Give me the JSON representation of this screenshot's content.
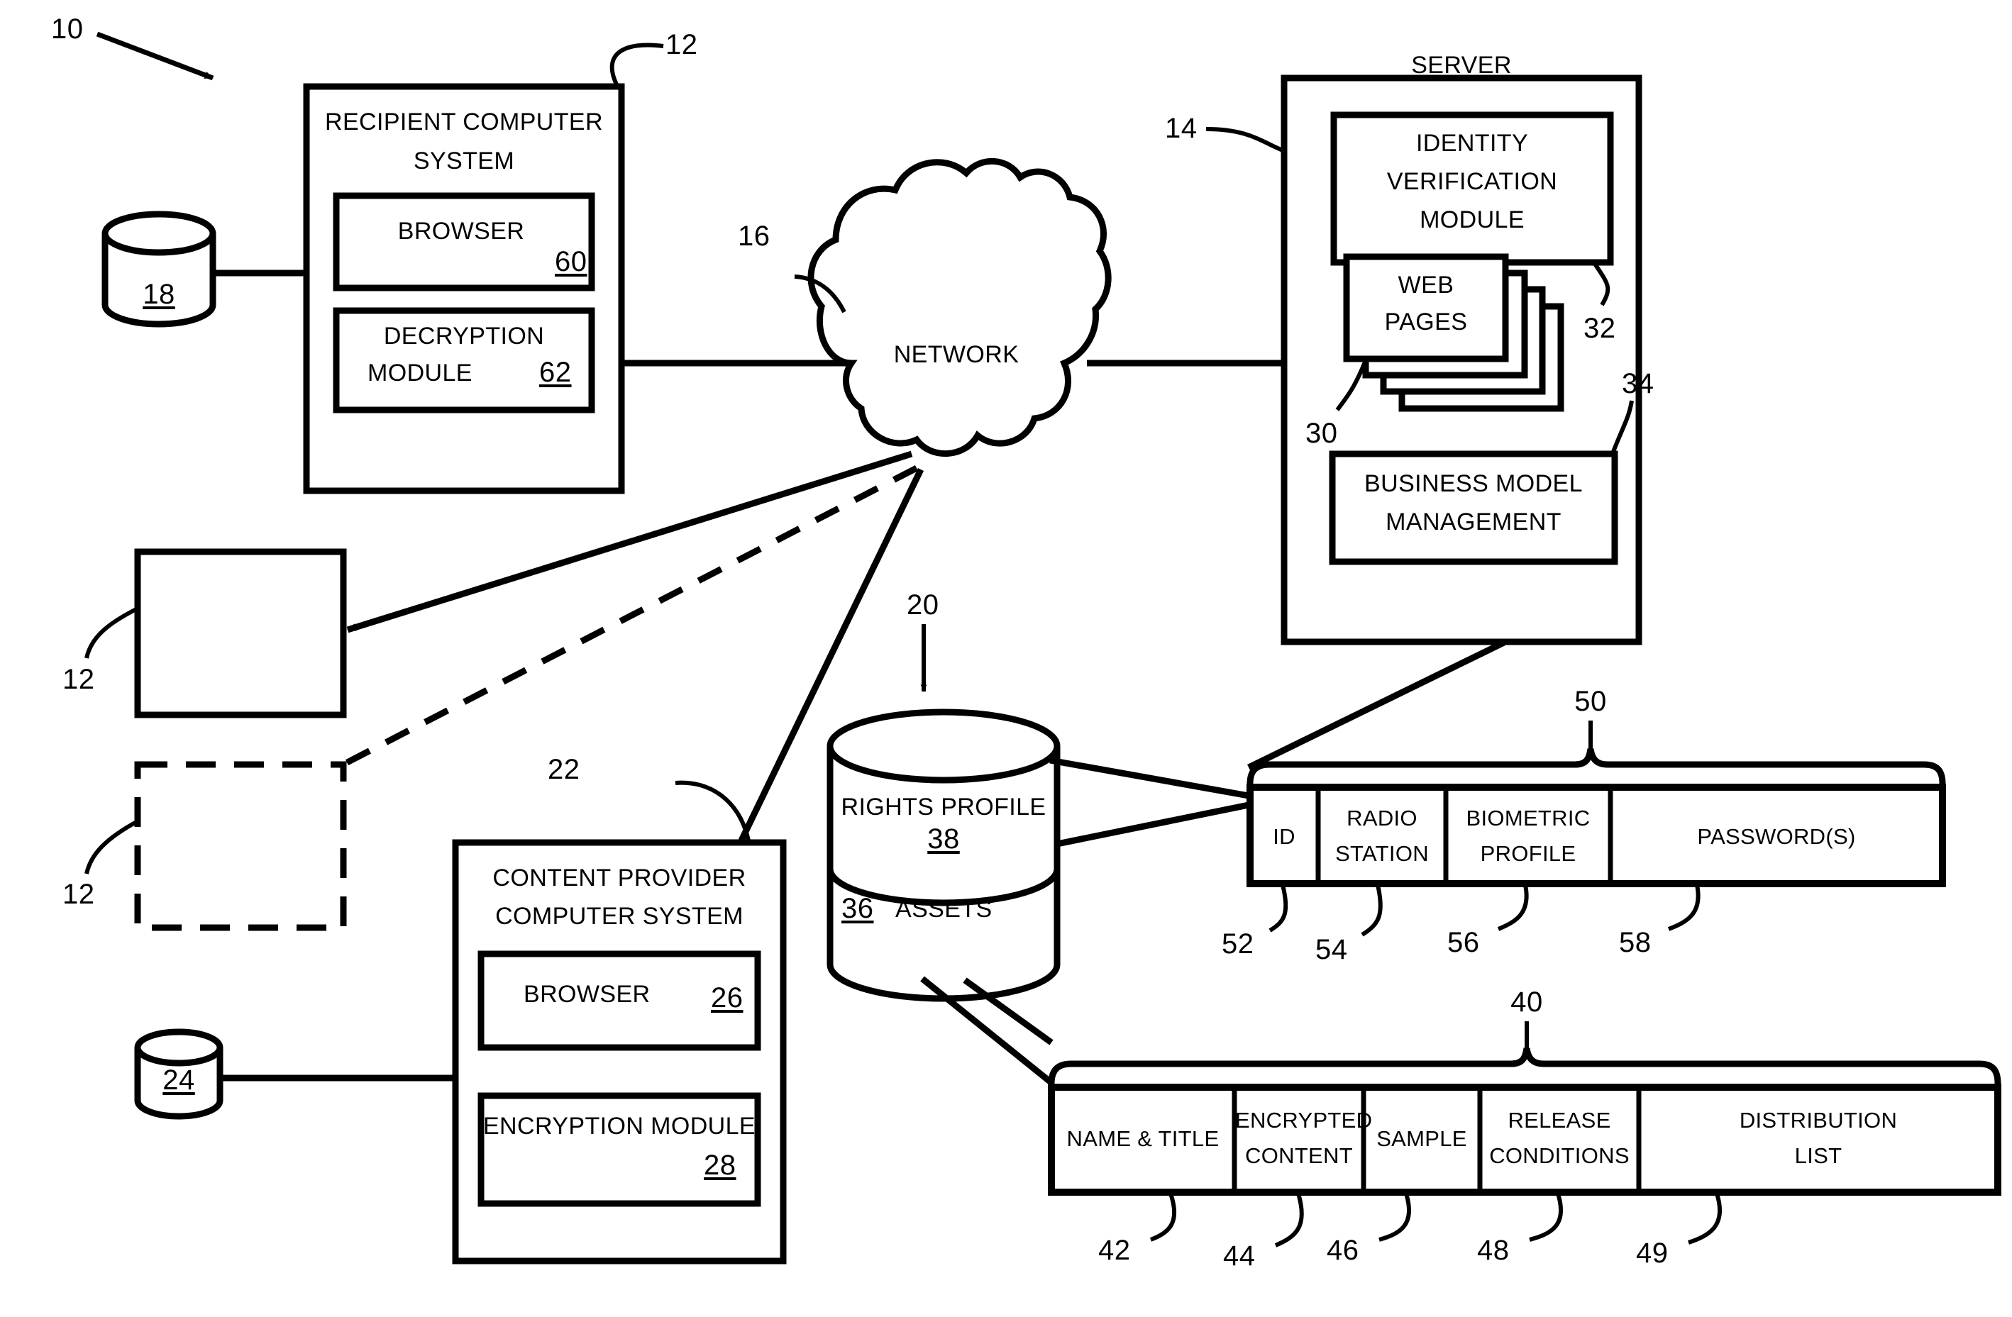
{
  "figure": {
    "type": "patent-system-block-diagram",
    "main_ref": "10"
  },
  "recipient_system": {
    "title_line1": "RECIPIENT COMPUTER",
    "title_line2": "SYSTEM",
    "ref": "12",
    "browser": {
      "label": "BROWSER",
      "ref": "60"
    },
    "decryption": {
      "label_line1": "DECRYPTION",
      "label_line2": "MODULE",
      "ref": "62"
    },
    "database_ref": "18"
  },
  "recipient_copies": [
    {
      "ref": "12",
      "style": "solid"
    },
    {
      "ref": "12",
      "style": "dashed"
    }
  ],
  "network": {
    "label": "NETWORK",
    "ref": "16"
  },
  "server": {
    "title": "SERVER",
    "ref": "14",
    "identity_module": {
      "line1": "IDENTITY",
      "line2": "VERIFICATION",
      "line3": "MODULE",
      "ref": "32"
    },
    "web_pages": {
      "line1": "WEB",
      "line2": "PAGES",
      "ref": "30"
    },
    "business_model": {
      "line1": "BUSINESS MODEL",
      "line2": "MANAGEMENT",
      "ref": "34"
    }
  },
  "content_provider": {
    "title_line1": "CONTENT PROVIDER",
    "title_line2": "COMPUTER SYSTEM",
    "ref": "22",
    "browser": {
      "label": "BROWSER",
      "ref": "26"
    },
    "encryption": {
      "label": "ENCRYPTION MODULE",
      "ref": "28"
    },
    "database_ref": "24"
  },
  "storage": {
    "ref": "20",
    "rights_profile": {
      "label": "RIGHTS PROFILE",
      "ref": "38"
    },
    "assets": {
      "label": "ASSETS",
      "ref": "36"
    }
  },
  "rights_profile_record": {
    "brace_ref": "50",
    "cells": [
      {
        "line1": "ID",
        "line2": "",
        "ref": "52"
      },
      {
        "line1": "RADIO",
        "line2": "STATION",
        "ref": "54"
      },
      {
        "line1": "BIOMETRIC",
        "line2": "PROFILE",
        "ref": "56"
      },
      {
        "line1": "PASSWORD(S)",
        "line2": "",
        "ref": "58"
      }
    ]
  },
  "asset_record": {
    "brace_ref": "40",
    "cells": [
      {
        "line1": "NAME & TITLE",
        "line2": "",
        "ref": "42"
      },
      {
        "line1": "ENCRYPTED",
        "line2": "CONTENT",
        "ref": "44"
      },
      {
        "line1": "SAMPLE",
        "line2": "",
        "ref": "46"
      },
      {
        "line1": "RELEASE",
        "line2": "CONDITIONS",
        "ref": "48"
      },
      {
        "line1": "DISTRIBUTION",
        "line2": "LIST",
        "ref": "49"
      }
    ]
  },
  "colors": {
    "ink": "#000000",
    "paper": "#ffffff"
  }
}
